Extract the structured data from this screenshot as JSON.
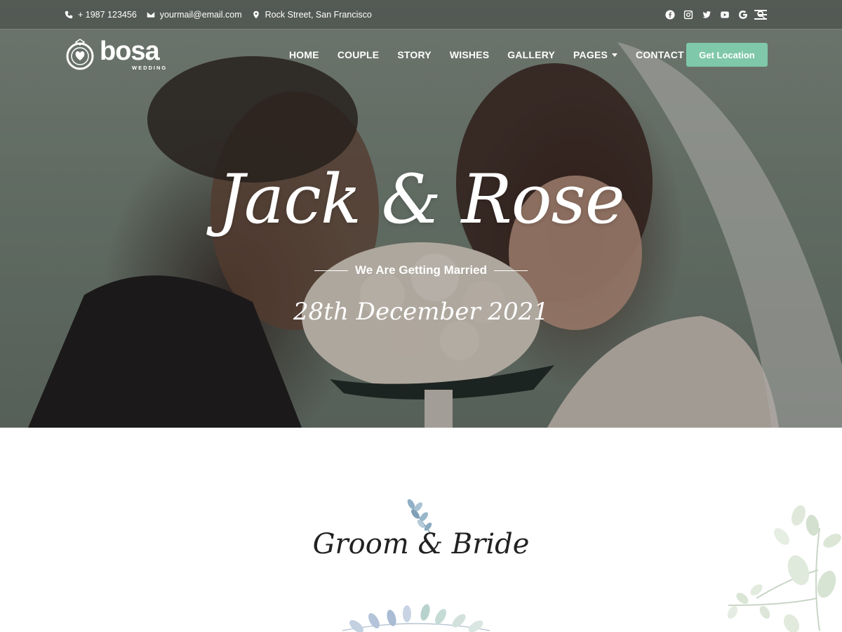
{
  "topbar": {
    "phone": "+ 1987 123456",
    "email": "yourmail@email.com",
    "address": "Rock Street, San Francisco"
  },
  "social": [
    "facebook-icon",
    "instagram-icon",
    "twitter-icon",
    "youtube-icon",
    "google-icon",
    "search-icon"
  ],
  "logo": {
    "name": "bosa",
    "tagline": "WEDDING"
  },
  "nav": {
    "items": [
      "HOME",
      "COUPLE",
      "STORY",
      "WISHES",
      "GALLERY",
      "PAGES",
      "CONTACT"
    ],
    "cta": "Get Location"
  },
  "hero": {
    "title": "Jack & Rose",
    "subtitle": "We Are Getting Married",
    "date": "28th December 2021"
  },
  "section": {
    "title": "Groom & Bride"
  },
  "colors": {
    "accent": "#7fc8a9",
    "text_dark": "#222222",
    "leaf": "#9fb8c8"
  }
}
